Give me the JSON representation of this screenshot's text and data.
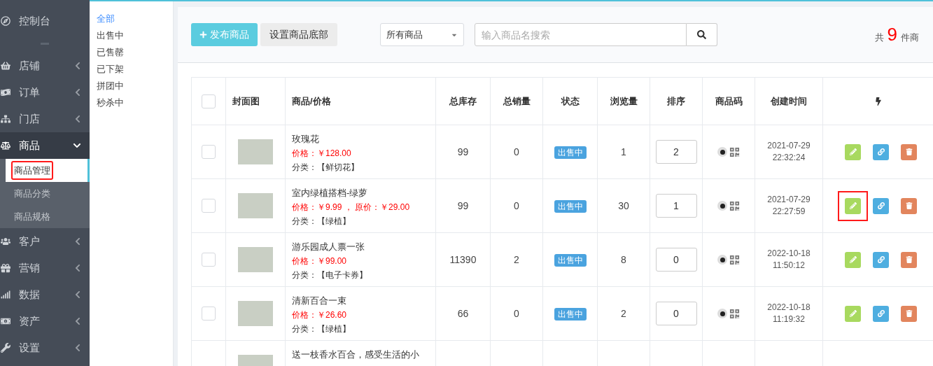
{
  "sidebar": {
    "items": [
      {
        "label": "控制台",
        "kind": "link"
      },
      {
        "label": "店铺",
        "kind": "menu",
        "expanded": false
      },
      {
        "label": "订单",
        "kind": "menu",
        "expanded": false
      },
      {
        "label": "门店",
        "kind": "menu",
        "expanded": false
      },
      {
        "label": "商品",
        "kind": "menu",
        "expanded": true,
        "children": [
          {
            "label": "商品管理",
            "selected": true,
            "highlighted": true
          },
          {
            "label": "商品分类",
            "selected": false,
            "highlighted": false
          },
          {
            "label": "商品规格",
            "selected": false,
            "highlighted": false
          }
        ]
      },
      {
        "label": "客户",
        "kind": "menu",
        "expanded": false
      },
      {
        "label": "营销",
        "kind": "menu",
        "expanded": false
      },
      {
        "label": "数据",
        "kind": "menu",
        "expanded": false
      },
      {
        "label": "资产",
        "kind": "menu",
        "expanded": false
      },
      {
        "label": "设置",
        "kind": "menu",
        "expanded": false
      }
    ]
  },
  "filters": [
    {
      "label": "全部",
      "selected": true
    },
    {
      "label": "出售中",
      "selected": false
    },
    {
      "label": "已售罄",
      "selected": false
    },
    {
      "label": "已下架",
      "selected": false
    },
    {
      "label": "拼团中",
      "selected": false
    },
    {
      "label": "秒杀中",
      "selected": false
    }
  ],
  "toolbar": {
    "publish_button": "发布商品",
    "footer_button": "设置商品底部",
    "category_select": "所有商品",
    "search_placeholder": "输入商品名搜索",
    "total": {
      "prefix": "共",
      "count": "9",
      "suffix": "件商"
    }
  },
  "table": {
    "select_all": {
      "checked": false
    },
    "columns": [
      "封面图",
      "商品/价格",
      "总库存",
      "总销量",
      "状态",
      "浏览量",
      "排序",
      "商品码",
      "创建时间"
    ],
    "rows": [
      {
        "checked": false,
        "name": "玫瑰花",
        "price": "价格：￥128.00",
        "category": "分类：【鲜切花】",
        "stock": "99",
        "sales": "0",
        "status": "出售中",
        "views": "1",
        "sort": "2",
        "date": "2021-07-29",
        "time": "22:32:24",
        "edit_highlighted": false
      },
      {
        "checked": false,
        "name": "室内绿植搭档-绿萝",
        "price": "价格：￥9.99 ， 原价：￥29.00",
        "category": "分类：【绿植】",
        "stock": "99",
        "sales": "0",
        "status": "出售中",
        "views": "30",
        "sort": "1",
        "date": "2021-07-29",
        "time": "22:27:59",
        "edit_highlighted": true
      },
      {
        "checked": false,
        "name": "游乐园成人票一张",
        "price": "价格：￥99.00",
        "category": "分类：【电子卡券】",
        "stock": "11390",
        "sales": "2",
        "status": "出售中",
        "views": "8",
        "sort": "0",
        "date": "2022-10-18",
        "time": "11:50:12",
        "edit_highlighted": false
      },
      {
        "checked": false,
        "name": "清新百合一束",
        "price": "价格：￥26.60",
        "category": "分类：【绿植】",
        "stock": "66",
        "sales": "0",
        "status": "出售中",
        "views": "2",
        "sort": "0",
        "date": "2022-10-18",
        "time": "11:19:32",
        "edit_highlighted": false
      },
      {
        "name": "送一枝香水百合，感受生活的小"
      }
    ]
  }
}
